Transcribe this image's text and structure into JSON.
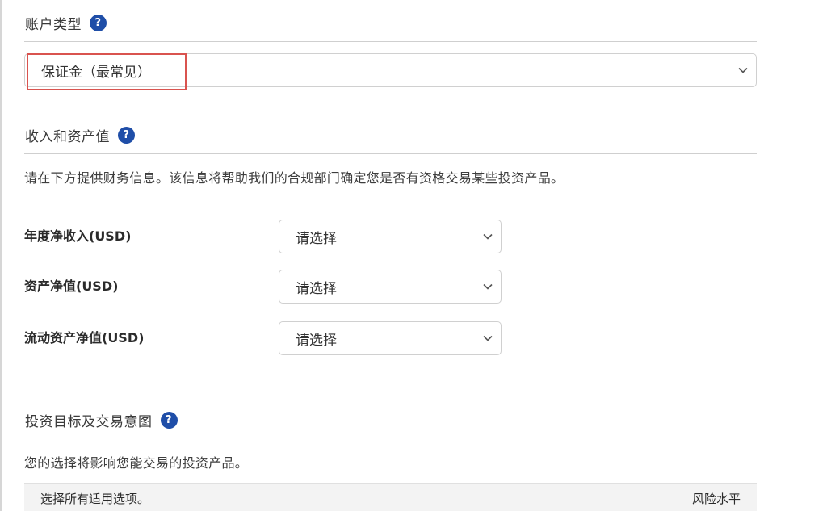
{
  "account_type": {
    "heading": "账户类型",
    "help_glyph": "?",
    "select_value": "保证金（最常见）",
    "highlight_color": "#d9534f"
  },
  "income_assets": {
    "heading": "收入和资产值",
    "help_glyph": "?",
    "description": "请在下方提供财务信息。该信息将帮助我们的合规部门确定您是否有资格交易某些投资产品。",
    "fields": [
      {
        "label": "年度净收入(USD)",
        "value": "请选择"
      },
      {
        "label": "资产净值(USD)",
        "value": "请选择"
      },
      {
        "label": "流动资产净值(USD)",
        "value": "请选择"
      }
    ]
  },
  "investment_goals": {
    "heading": "投资目标及交易意图",
    "help_glyph": "?",
    "description": "您的选择将影响您能交易的投资产品。",
    "table_header_left": "选择所有适用选项。",
    "table_header_right": "风险水平"
  },
  "colors": {
    "help_icon": "#1f4ea8",
    "divider": "#cfcfcf",
    "table_header_bg": "#f3f3f3"
  },
  "icons": {
    "help": "question-circle-icon",
    "dropdown": "chevron-down-icon"
  }
}
